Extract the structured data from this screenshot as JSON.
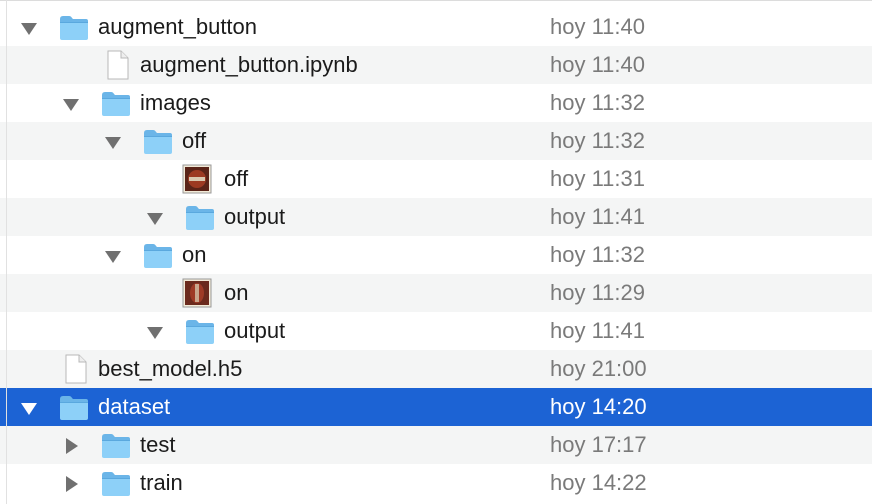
{
  "files": [
    {
      "name": "augment_button",
      "date": "hoy 11:40",
      "kind": "folder",
      "expanded": true,
      "depth": 0
    },
    {
      "name": "augment_button.ipynb",
      "date": "hoy 11:40",
      "kind": "document",
      "depth": 1
    },
    {
      "name": "images",
      "date": "hoy 11:32",
      "kind": "folder",
      "expanded": true,
      "depth": 1
    },
    {
      "name": "off",
      "date": "hoy 11:32",
      "kind": "folder",
      "expanded": true,
      "depth": 2
    },
    {
      "name": "off",
      "date": "hoy 11:31",
      "kind": "image-thumbnail",
      "depth": 3
    },
    {
      "name": "output",
      "date": "hoy 11:41",
      "kind": "folder",
      "expanded": true,
      "depth": 3
    },
    {
      "name": "on",
      "date": "hoy 11:32",
      "kind": "folder",
      "expanded": true,
      "depth": 2
    },
    {
      "name": "on",
      "date": "hoy 11:29",
      "kind": "image-thumbnail",
      "depth": 3
    },
    {
      "name": "output",
      "date": "hoy 11:41",
      "kind": "folder",
      "expanded": true,
      "depth": 3
    },
    {
      "name": "best_model.h5",
      "date": "hoy 21:00",
      "kind": "document",
      "depth": 0
    },
    {
      "name": "dataset",
      "date": "hoy 14:20",
      "kind": "folder",
      "expanded": true,
      "depth": 0,
      "selected": true
    },
    {
      "name": "test",
      "date": "hoy 17:17",
      "kind": "folder",
      "expanded": false,
      "depth": 1
    },
    {
      "name": "train",
      "date": "hoy 14:22",
      "kind": "folder",
      "expanded": false,
      "depth": 1
    }
  ],
  "colors": {
    "selection": "#1c63d4",
    "folder": "#7cc5f5",
    "alt_row": "#f4f5f5"
  }
}
